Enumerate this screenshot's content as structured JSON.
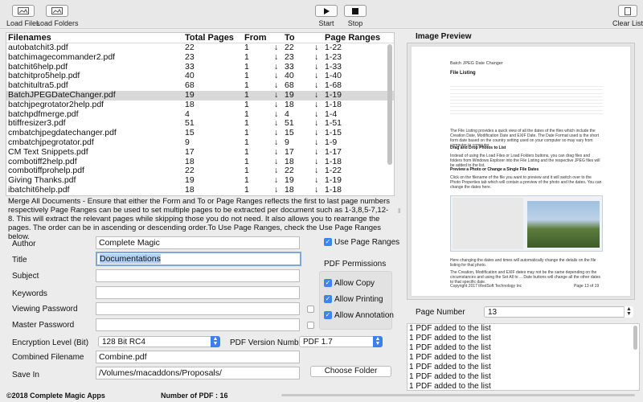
{
  "toolbar": {
    "load_files": "Load Files",
    "load_folders": "Load Folders",
    "start": "Start",
    "stop": "Stop",
    "clear_list": "Clear List"
  },
  "table": {
    "headers": {
      "filenames": "Filenames",
      "total_pages": "Total Pages",
      "from": "From",
      "to": "To",
      "page_ranges": "Page Ranges"
    },
    "rows": [
      {
        "name": "autobatchit3.pdf",
        "total": "22",
        "from": "1",
        "to": "22",
        "range": "1-22"
      },
      {
        "name": "batchimagecommander2.pdf",
        "total": "23",
        "from": "1",
        "to": "23",
        "range": "1-23"
      },
      {
        "name": "batchit6help.pdf",
        "total": "33",
        "from": "1",
        "to": "33",
        "range": "1-33"
      },
      {
        "name": "batchitpro5help.pdf",
        "total": "40",
        "from": "1",
        "to": "40",
        "range": "1-40"
      },
      {
        "name": "batchitultra5.pdf",
        "total": "68",
        "from": "1",
        "to": "68",
        "range": "1-68"
      },
      {
        "name": "BatchJPEGDateChanger.pdf",
        "total": "19",
        "from": "1",
        "to": "19",
        "range": "1-19"
      },
      {
        "name": "batchjpegrotator2help.pdf",
        "total": "18",
        "from": "1",
        "to": "18",
        "range": "1-18"
      },
      {
        "name": "batchpdfmerge.pdf",
        "total": "4",
        "from": "1",
        "to": "4",
        "range": "1-4"
      },
      {
        "name": "btiffresizer3.pdf",
        "total": "51",
        "from": "1",
        "to": "51",
        "range": "1-51"
      },
      {
        "name": "cmbatchjpegdatechanger.pdf",
        "total": "15",
        "from": "1",
        "to": "15",
        "range": "1-15"
      },
      {
        "name": "cmbatchjpegrotator.pdf",
        "total": "9",
        "from": "1",
        "to": "9",
        "range": "1-9"
      },
      {
        "name": "CM Text Snippets.pdf",
        "total": "17",
        "from": "1",
        "to": "17",
        "range": "1-17"
      },
      {
        "name": "combotiff2help.pdf",
        "total": "18",
        "from": "1",
        "to": "18",
        "range": "1-18"
      },
      {
        "name": "combotiffprohelp.pdf",
        "total": "22",
        "from": "1",
        "to": "22",
        "range": "1-22"
      },
      {
        "name": "Giving Thanks.pdf",
        "total": "19",
        "from": "1",
        "to": "19",
        "range": "1-19"
      },
      {
        "name": "ibatchit6help.pdf",
        "total": "18",
        "from": "1",
        "to": "18",
        "range": "1-18"
      }
    ],
    "selected_index": 5
  },
  "info_text": "Merge All Documents - Ensure that either the Form and To or Page Ranges reflects the first to last page numbers respectively Page Ranges can be used to set multiple pages to be extracted per document such as 1-3,8,5-7,12-8. This will extract the relevant pages while skipping those you do not need. It also allows you to rearrange the pages. The order can be in ascending or descending order.To Use Page Ranges, check the Use Page Ranges below.",
  "form": {
    "author_label": "Author",
    "author_value": "Complete Magic",
    "title_label": "Title",
    "title_value": "Documentations",
    "subject_label": "Subject",
    "subject_value": "",
    "keywords_label": "Keywords",
    "keywords_value": "",
    "viewing_password_label": "Viewing Password",
    "viewing_password_value": "",
    "master_password_label": "Master Password",
    "master_password_value": "",
    "encryption_label": "Encryption Level (Bit)",
    "encryption_value": "128 Bit RC4",
    "pdf_version_label": "PDF Version Number",
    "pdf_version_value": "PDF 1.7",
    "combined_label": "Combined Filename",
    "combined_value": "Combine.pdf",
    "save_in_label": "Save In",
    "save_in_value": "/Volumes/macaddons/Proposals/",
    "choose_folder": "Choose Folder",
    "use_page_ranges": "Use Page Ranges",
    "pdf_permissions": "PDF Permissions",
    "allow_copy": "Allow Copy",
    "allow_printing": "Allow Printing",
    "allow_annotation": "Allow Annotation"
  },
  "preview": {
    "title": "Image Preview",
    "page_header": "Batch JPEG Date Changer",
    "page_heading": "File Listing",
    "para1": "The File Listing provides a quick view of all the dates of the files which include the Creation Date, Modification Date and EXIF Date. The Date Format used is the short form date based on the country setting used on your computer so may vary from computer to computer.",
    "heading2": "Drag and Drop Photos to List",
    "para2": "Instead of using the Load Files or Load Folders buttons, you can drag files and folders from Windows Explorer into the File Listing and the respective JPEG files will be added to the list.",
    "heading3": "Preview a Photo or Change a Single File Dates",
    "para3": "Click on the filename of the file you want to preview and it will switch over to the Photo Properties tab which will contain a preview of the photo and the dates. You can change the dates here.",
    "para4": "Here changing the dates and times will automatically change the details on the file listing for that photo.",
    "para5": "The Creation, Modification and EXIF dates may not be the same depending on the circumstances and using the Set All to ... Date buttons will change all the other dates to that specific date.",
    "footer_left": "Copyright 2017 iRedSoft Technology Inc",
    "footer_right": "Page 13 of 19"
  },
  "page_number_label": "Page Number",
  "page_number_value": "13",
  "log": [
    "1 PDF added to the list",
    "1 PDF added to the list",
    "1 PDF added to the list",
    "1 PDF added to the list",
    "1 PDF added to the list",
    "1 PDF added to the list",
    "1 PDF added to the list"
  ],
  "footer": {
    "copyright": "©2018 Complete Magic Apps",
    "count": "Number of PDF : 16"
  }
}
